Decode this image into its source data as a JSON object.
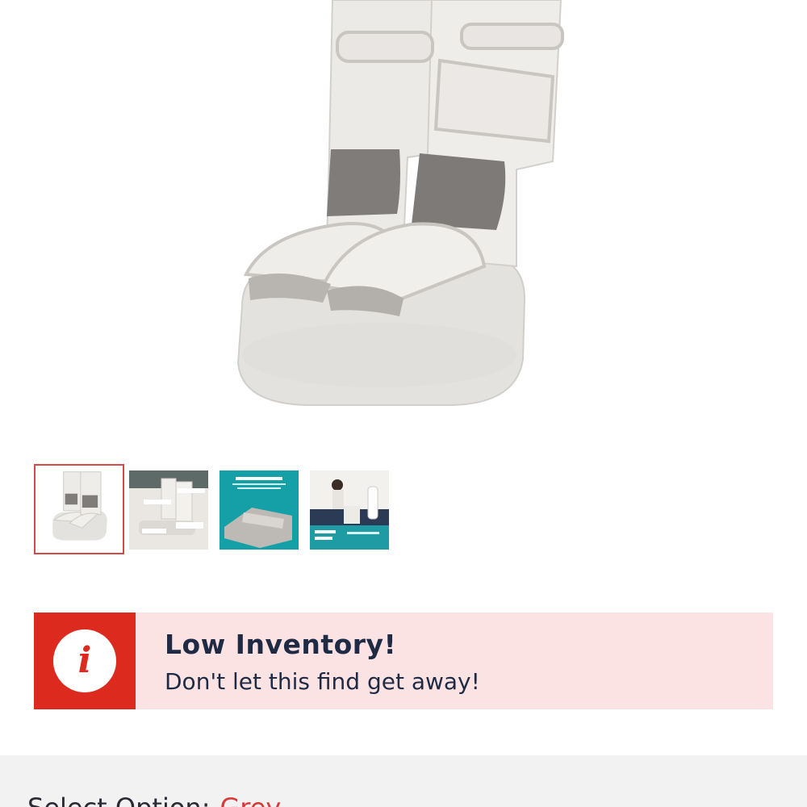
{
  "product": {
    "main_image_alt": "Grey leg massager boots",
    "thumbnails": [
      {
        "label": "main product view",
        "selected": true
      },
      {
        "label": "features diagram",
        "selected": false,
        "caption_text": ""
      },
      {
        "label": "recovery on the move",
        "selected": false,
        "caption_text": "recovery on the move"
      },
      {
        "label": "control at your fingertips",
        "selected": false,
        "caption_text": "control at your fingertips"
      }
    ]
  },
  "alert": {
    "icon": "info-icon",
    "icon_glyph": "i",
    "title": "Low Inventory!",
    "message": "Don't let this find get away!"
  },
  "options": {
    "label": "Select Option:",
    "value": "Grey"
  },
  "colors": {
    "alert_side": "#dc2a1f",
    "alert_bg": "#fbe3e3",
    "selected_border": "#d24a4a",
    "option_value": "#d83a3a"
  }
}
